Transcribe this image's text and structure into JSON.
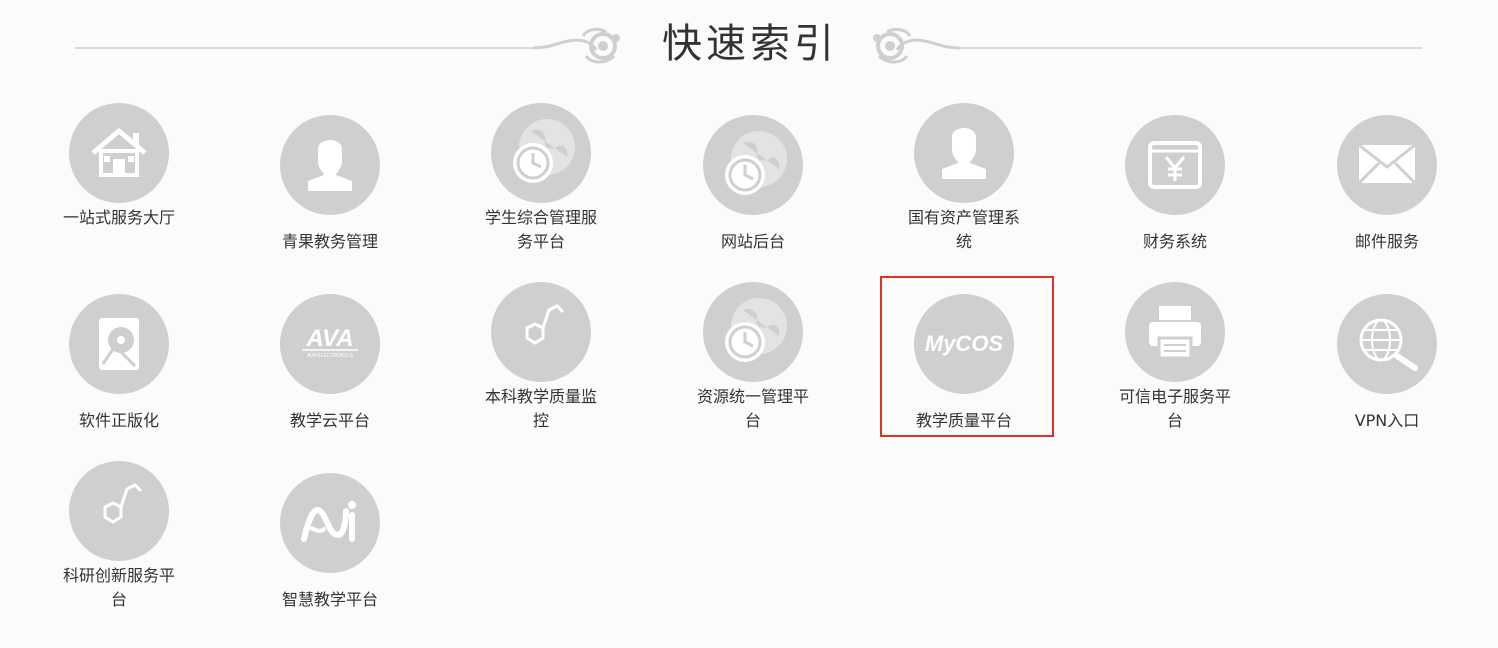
{
  "header": {
    "title": "快速索引"
  },
  "colors": {
    "icon_bg": "#cfcfcf",
    "icon_fg": "#ffffff",
    "highlight": "#e32f1f",
    "line": "#dcdcdc"
  },
  "tiles": [
    {
      "label": "一站式服务大厅",
      "icon": "house-icon"
    },
    {
      "label": "青果教务管理",
      "icon": "user-icon"
    },
    {
      "label": "学生综合管理服务平台",
      "icon": "globe-clock-icon"
    },
    {
      "label": "网站后台",
      "icon": "globe-clock-icon"
    },
    {
      "label": "国有资产管理系统",
      "icon": "user-icon"
    },
    {
      "label": "财务系统",
      "icon": "yen-icon"
    },
    {
      "label": "邮件服务",
      "icon": "envelope-icon"
    },
    {
      "label": "软件正版化",
      "icon": "disk-icon"
    },
    {
      "label": "教学云平台",
      "icon": "ava-logo-icon",
      "logo_text": "AVA",
      "logo_subtext": "AVA ELECTRONICS"
    },
    {
      "label": "本科教学质量监控",
      "icon": "molecule-icon"
    },
    {
      "label": "资源统一管理平台",
      "icon": "globe-clock-icon"
    },
    {
      "label": "教学质量平台",
      "icon": "mycos-logo-icon",
      "logo_text": "MyCOS",
      "highlighted": true
    },
    {
      "label": "可信电子服务平台",
      "icon": "printer-icon"
    },
    {
      "label": "VPN入口",
      "icon": "globe-search-icon"
    },
    {
      "label": "科研创新服务平台",
      "icon": "molecule-icon"
    },
    {
      "label": "智慧教学平台",
      "icon": "ai-logo-icon"
    }
  ]
}
